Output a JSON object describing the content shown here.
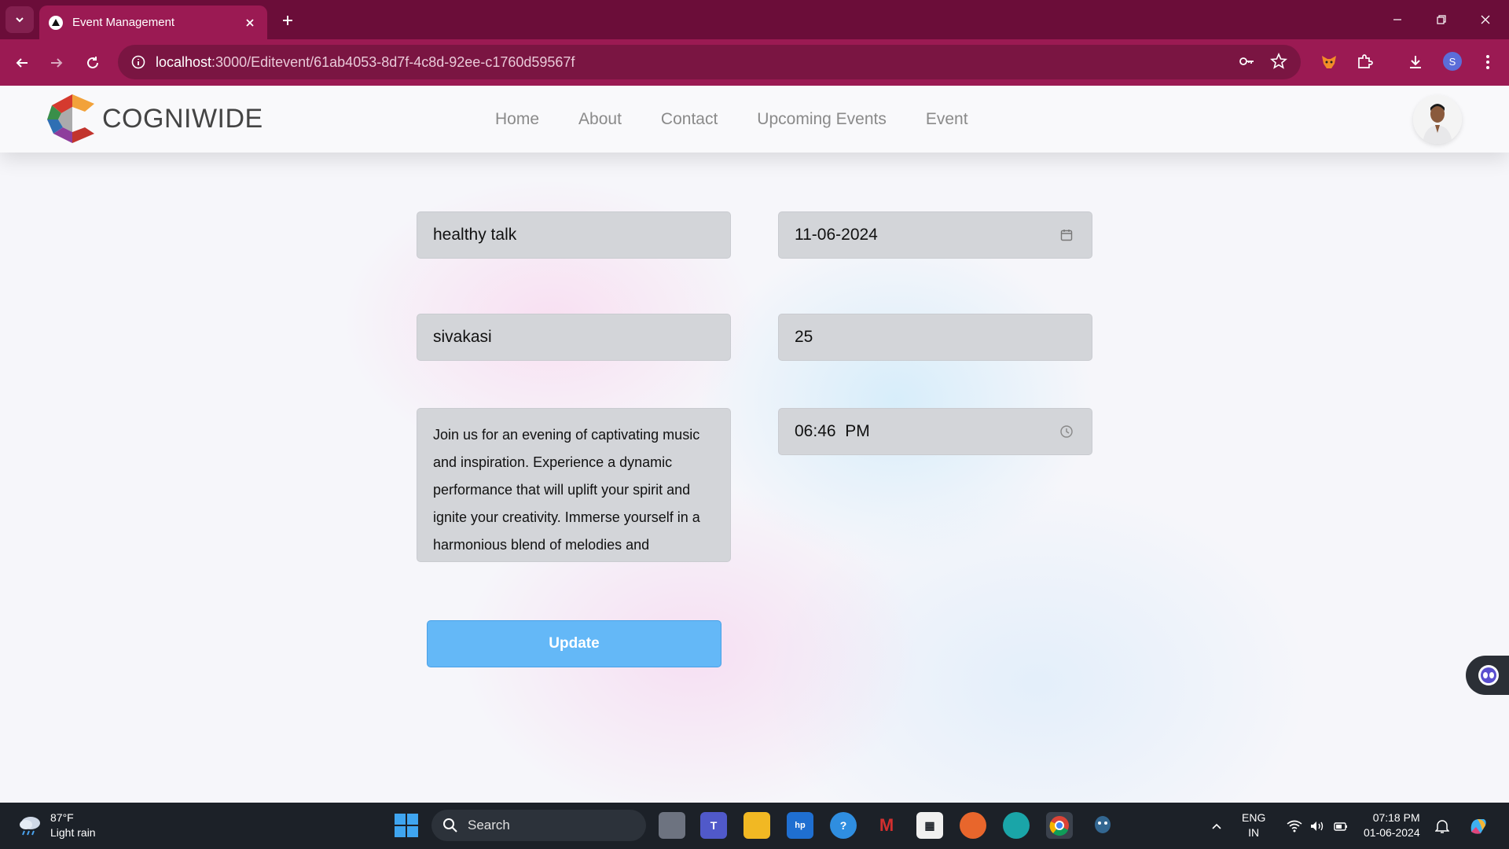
{
  "browser": {
    "tab_title": "Event Management",
    "url_host": "localhost",
    "url_path": ":3000/Editevent/61ab4053-8d7f-4c8d-92ee-c1760d59567f",
    "profile_initial": "S",
    "accent_color": "#9b1a53"
  },
  "navbar": {
    "logo_text": "COGNIWIDE",
    "links": [
      "Home",
      "About",
      "Contact",
      "Upcoming Events",
      "Event"
    ]
  },
  "form": {
    "event_name": "healthy talk",
    "event_date": "11-06-2024",
    "location": "sivakasi",
    "capacity": "25",
    "description": "Join us for an evening of captivating music and inspiration. Experience a dynamic performance that will uplift your spirit and ignite your creativity. Immerse yourself in a harmonious blend of melodies and",
    "time": "06:46  PM",
    "submit_label": "Update"
  },
  "taskbar": {
    "weather_temp": "87°F",
    "weather_desc": "Light rain",
    "search_placeholder": "Search",
    "lang_line1": "ENG",
    "lang_line2": "IN",
    "time": "07:18 PM",
    "date": "01-06-2024"
  }
}
